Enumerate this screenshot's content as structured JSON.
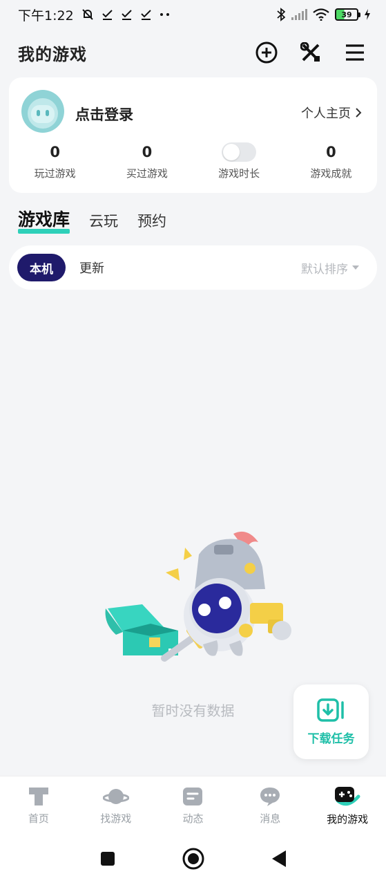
{
  "status_bar": {
    "time": "下午1:22",
    "battery": "39"
  },
  "header": {
    "title": "我的游戏"
  },
  "profile": {
    "login_text": "点击登录",
    "homepage_link": "个人主页",
    "stats": [
      {
        "value": "0",
        "label": "玩过游戏"
      },
      {
        "value": "0",
        "label": "买过游戏"
      },
      {
        "value": "",
        "label": "游戏时长"
      },
      {
        "value": "0",
        "label": "游戏成就"
      }
    ]
  },
  "tabs": [
    {
      "label": "游戏库",
      "active": true
    },
    {
      "label": "云玩",
      "active": false
    },
    {
      "label": "预约",
      "active": false
    }
  ],
  "filter": {
    "active_chip": "本机",
    "chip": "更新",
    "sort": "默认排序"
  },
  "empty_state": {
    "text": "暂时没有数据"
  },
  "download": {
    "label": "下载任务"
  },
  "bottom_nav": [
    {
      "label": "首页",
      "icon": "home-icon"
    },
    {
      "label": "找游戏",
      "icon": "planet-icon"
    },
    {
      "label": "动态",
      "icon": "feed-icon"
    },
    {
      "label": "消息",
      "icon": "message-icon"
    },
    {
      "label": "我的游戏",
      "icon": "gamepad-icon"
    }
  ],
  "colors": {
    "accent": "#2ed0b9",
    "chip_active": "#1f1a6b",
    "background": "#f4f5f7"
  }
}
